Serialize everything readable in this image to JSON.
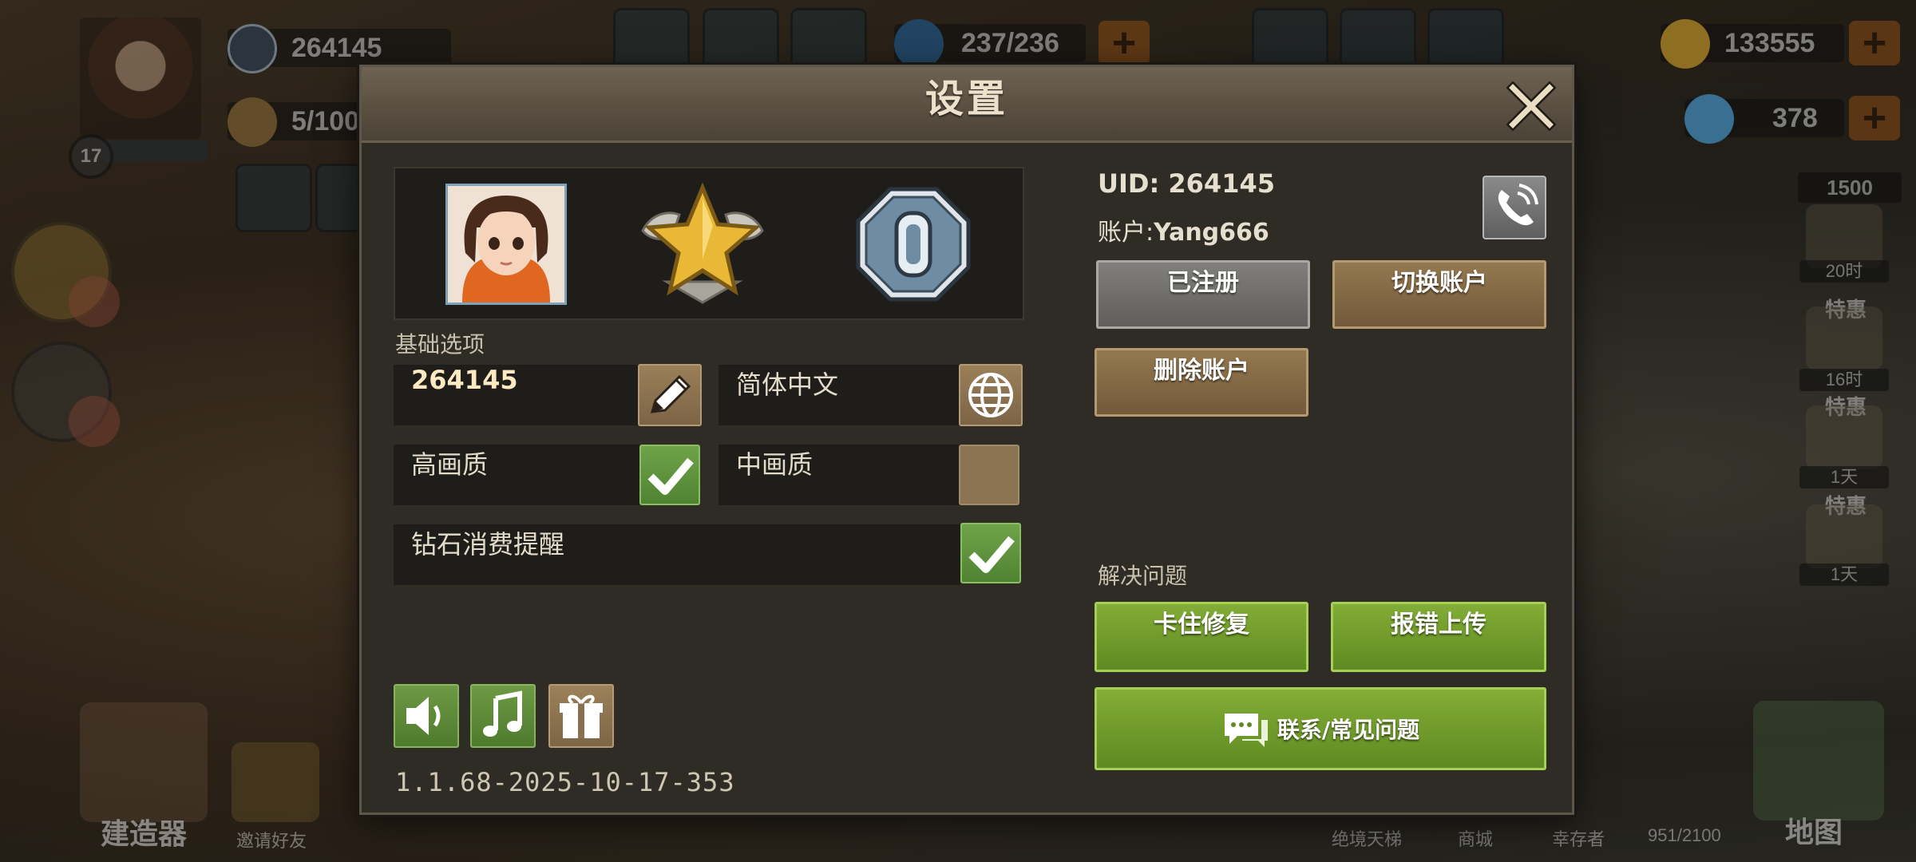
{
  "hud": {
    "player_level": "17",
    "player_id": "264145",
    "worker_count": "5/100",
    "energy": "237/236",
    "gold": "133555",
    "diamonds": "378",
    "side_badge": "1500",
    "side_timers": [
      "20时",
      "16时",
      "1天",
      "1天"
    ],
    "side_titles": [
      "特惠",
      "特惠",
      "特惠"
    ],
    "bottom_left_labels": [
      "建造器",
      "邀请好友"
    ],
    "bottom_right_labels": [
      "绝境天梯",
      "商城",
      "幸存者",
      "951/2100"
    ],
    "map_label": "地图"
  },
  "settings": {
    "title": "设置",
    "basic_section_label": "基础选项",
    "name_value": "264145",
    "language_value": "简体中文",
    "high_quality_label": "高画质",
    "high_quality_checked": true,
    "mid_quality_label": "中画质",
    "mid_quality_checked": false,
    "diamond_reminder_label": "钻石消费提醒",
    "diamond_reminder_checked": true,
    "version": "1.1.68-2025-10-17-353",
    "sound_on": true,
    "music_on": true
  },
  "account": {
    "uid_line": "UID: 264145",
    "account_prefix": "账户:",
    "account_name": "Yang666",
    "registered_btn": "已注册",
    "switch_btn": "切换账户",
    "delete_btn": "删除账户"
  },
  "support": {
    "section_label": "解决问题",
    "stuck_fix_btn": "卡住修复",
    "report_btn": "报错上传",
    "contact_btn": "联系/常见问题"
  },
  "colors": {
    "accent_green": "#6fa34a",
    "accent_brown": "#93784f",
    "panel_bg": "#2f2c26",
    "header_bg": "#5a5042"
  }
}
